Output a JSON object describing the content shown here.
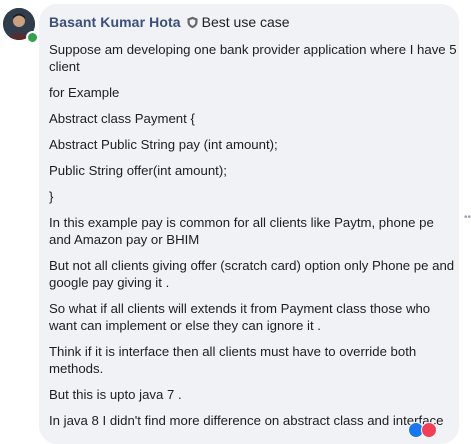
{
  "comment": {
    "author": "Basant Kumar Hota",
    "badge_icon": "shield-badge-icon",
    "badge_text": "Best use case",
    "paragraphs": [
      "Suppose am developing one bank provider application where I have 5 client",
      "for Example",
      "Abstract class Payment {",
      "Abstract Public String pay (int amount);",
      "Public String offer(int amount);",
      "}",
      "In this example pay is common for all clients like Paytm, phone pe and Amazon pay or BHIM",
      "But not all clients giving offer (scratch card) option only Phone pe and google pay giving it .",
      "So what if all clients will extends it from Payment class those who want can implement or else they can ignore it .",
      "Think if it is interface then all clients must have to override both methods.",
      "But this is upto java 7 .",
      "In java 8 I didn't find more difference on abstract class and interface"
    ]
  },
  "icons": {
    "avatar": "user-avatar-icon",
    "online": "online-status-icon",
    "more": "more-options-icon",
    "reactions": [
      "like-reaction-icon",
      "love-reaction-icon"
    ]
  },
  "colors": {
    "bubble_bg": "#f0f2f5",
    "author": "#3b4f7a",
    "text": "#1c1e21",
    "online": "#31a24c",
    "like": "#1877f2",
    "love": "#f33e58"
  }
}
